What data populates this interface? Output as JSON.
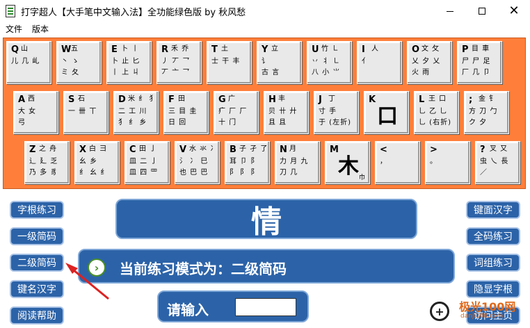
{
  "window": {
    "title": "打字超人【大手笔中文输入法】全功能绿色版 by 秋风愁",
    "minimize_label": "—",
    "maximize_label": "□",
    "close_label": "✕"
  },
  "menu": {
    "items": [
      "文件",
      "版本"
    ]
  },
  "keyboard": {
    "row1": [
      {
        "letter": "Q",
        "r1": "山",
        "r2": "儿 几 乢",
        "r3": ""
      },
      {
        "letter": "W",
        "r1": "五",
        "r2": "丶 ゝ",
        "r3": "ミ 夂"
      },
      {
        "letter": "E",
        "r1": "卜 丨",
        "r2": "卜 止 匕",
        "r3": "丨 上 丩"
      },
      {
        "letter": "R",
        "r1": "禾 乔",
        "r2": "丿 丆 乛",
        "r3": "丆 亠 乛"
      },
      {
        "letter": "T",
        "r1": "土",
        "r2": "士 干 丰",
        "r3": ""
      },
      {
        "letter": "Y",
        "r1": "立",
        "r2": "讠",
        "r3": "古  言"
      },
      {
        "letter": "U",
        "r1": "竹 ㇗",
        "r2": "丷 丬 ㇗",
        "r3": "八 小 ⺌"
      },
      {
        "letter": "I",
        "r1": "人",
        "r2": "亻",
        "r3": ""
      },
      {
        "letter": "O",
        "r1": "文 攵",
        "r2": "乂 夕 乂",
        "r3": "火 雨"
      },
      {
        "letter": "P",
        "r1": "目 車",
        "r2": "尸 尸 足",
        "r3": "厂 几 卩"
      }
    ],
    "row2": [
      {
        "letter": "A",
        "r1": "西",
        "r2": "大 女",
        "r3": "弓"
      },
      {
        "letter": "S",
        "r1": "石",
        "r2": "一 卌 丅",
        "r3": ""
      },
      {
        "letter": "D",
        "r1": "米 纟 犭",
        "r2": "二 工 川",
        "r3": "犭 纟 乡"
      },
      {
        "letter": "F",
        "r1": "田",
        "r2": "三 目 圭",
        "r3": "日 回"
      },
      {
        "letter": "G",
        "r1": "广",
        "r2": "疒 厂 厂",
        "r3": "十 门"
      },
      {
        "letter": "H",
        "r1": "丰",
        "r2": "贝 卄 廾",
        "r3": "且 且"
      },
      {
        "letter": "J",
        "r1": "丁",
        "r2": "寸 手",
        "r3": "于 (左折)"
      },
      {
        "letter": "K",
        "big": "口",
        "r1": "",
        "r2": "",
        "r3": ""
      },
      {
        "letter": "L",
        "r1": "王 口",
        "r2": "乚 乙 乚",
        "r3": "乚 (右折)"
      },
      {
        "letter": ";",
        "r1": "金 钅",
        "r2": "方 刀 勹",
        "r3": "ク 夕"
      }
    ],
    "row3": [
      {
        "letter": "Z",
        "r1": "之 舟",
        "r2": "辶 廴 乏",
        "r3": "乃 多 豸"
      },
      {
        "letter": "X",
        "r1": "白 彐",
        "r2": "幺 乡",
        "r3": "纟 幺 纟"
      },
      {
        "letter": "C",
        "r1": "田 亅",
        "r2": "皿 二 亅",
        "r3": "皿 四 罒"
      },
      {
        "letter": "V",
        "r1": "水 氺 冫",
        "r2": "氵 冫 巳",
        "r3": "也 巴 巴"
      },
      {
        "letter": "B",
        "r1": "子 孑 了",
        "r2": "耳 卩 阝",
        "r3": "阝 阝 阝"
      },
      {
        "letter": "N",
        "r1": "月",
        "r2": "力 月 九",
        "r3": "刀 几"
      },
      {
        "letter": "M",
        "big": "木",
        "small": "巾",
        "r1": "",
        "r2": "",
        "r3": ""
      },
      {
        "letter": "<",
        "r1": "",
        "r2": "，",
        "r3": ""
      },
      {
        "letter": ">",
        "r1": "",
        "r2": "。",
        "r3": ""
      },
      {
        "letter": "?",
        "r1": "叉 又",
        "r2": "虫 乀 長",
        "r3": "／"
      }
    ]
  },
  "side_left": [
    "字根练习",
    "一级简码",
    "二级简码",
    "键名汉字",
    "阅读帮助"
  ],
  "side_right": [
    "键面汉字",
    "全码练习",
    "词组练习",
    "隐显字根",
    "访问主页"
  ],
  "practice": {
    "current_char": "情",
    "mode_text": "当前练习模式为：二级简码",
    "input_label": "请输入",
    "input_value": ""
  },
  "watermark": {
    "title": "极光100网",
    "subtitle": "danji100.com"
  }
}
